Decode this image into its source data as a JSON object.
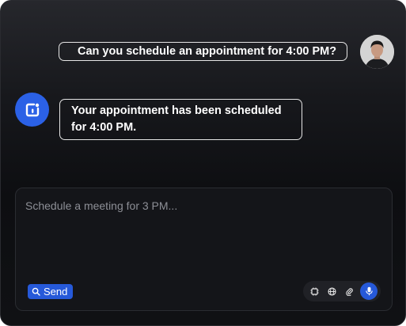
{
  "conversation": {
    "user_message": "Can you schedule an appointment for 4:00 PM?",
    "bot_message": "Your appointment has been scheduled for 4:00 PM."
  },
  "composer": {
    "placeholder": "Schedule a meeting for 3 PM...",
    "send_label": "Send",
    "tools": [
      "grid-icon",
      "globe-icon",
      "paperclip-icon",
      "microphone-icon"
    ]
  },
  "colors": {
    "accent": "#2659d9",
    "bot_avatar": "#2b61e6",
    "bubble_border": "#e6e6e6"
  }
}
